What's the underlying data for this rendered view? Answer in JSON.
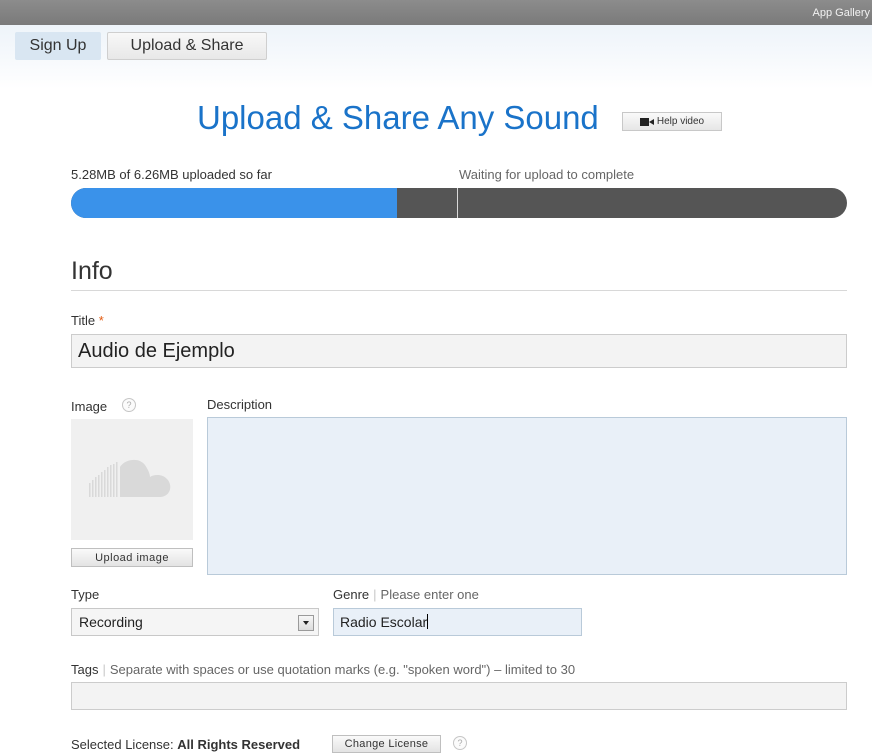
{
  "topbar": {
    "app_gallery": "App Gallery"
  },
  "nav": {
    "sign_up": "Sign Up",
    "upload_share": "Upload & Share"
  },
  "page": {
    "title": "Upload & Share Any Sound",
    "help_video": "Help video"
  },
  "upload": {
    "status_left": "5.28MB of 6.26MB uploaded so far",
    "status_right": "Waiting for upload to complete",
    "progress_fraction": 0.42
  },
  "info": {
    "heading": "Info",
    "title_label": "Title",
    "title_required_mark": "*",
    "title_value": "Audio de Ejemplo",
    "image_label": "Image",
    "help_mark": "?",
    "upload_image_label": "Upload image",
    "description_label": "Description",
    "description_value": "",
    "type_label": "Type",
    "type_value": "Recording",
    "genre_label": "Genre",
    "genre_hint": "Please enter one",
    "genre_value": "Radio Escolar",
    "tags_label": "Tags",
    "tags_hint": "Separate with spaces or use quotation marks (e.g. \"spoken word\") – limited to 30",
    "tags_value": "",
    "license_prefix": "Selected License:",
    "license_value": "All Rights Reserved",
    "change_license_label": "Change License"
  },
  "colors": {
    "accent": "#1a73c9",
    "progress_fill": "#3a92ea",
    "progress_track": "#555555",
    "required": "#e35a10"
  }
}
